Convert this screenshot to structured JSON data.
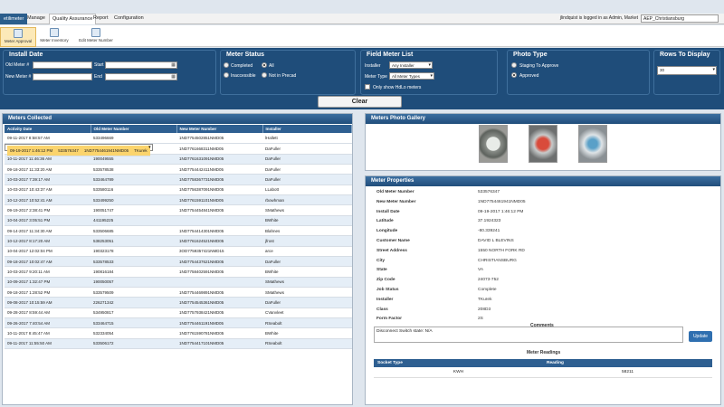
{
  "menu": {
    "items": [
      "etilimeter",
      "Manage",
      "Quality Assurance",
      "Report",
      "Configuration"
    ],
    "user_info": "jlindquist is logged in as Admin, Market",
    "market": "AEP_Christiansburg"
  },
  "ribbon": {
    "buttons": [
      "Meter Approval",
      "Meter Inventory",
      "Edit Meter Number"
    ]
  },
  "filters": {
    "install_date": {
      "title": "Install Date",
      "old_meter_label": "Old Meter #",
      "new_meter_label": "New Meter #",
      "start_label": "Start",
      "end_label": "End"
    },
    "meter_status": {
      "title": "Meter Status",
      "options": [
        "Completed",
        "All",
        "Inaccessible",
        "Not in Precad"
      ]
    },
    "field_meter_list": {
      "title": "Field Meter List",
      "installer_label": "Installer",
      "installer_value": "Any Installer",
      "meter_type_label": "Meter Type",
      "meter_type_value": "All Meter Types",
      "only_show_label": "Only show HdLo meters"
    },
    "photo_type": {
      "title": "Photo Type",
      "options": [
        "Staging To Approve",
        "Approved"
      ]
    },
    "rows_to_display": {
      "title": "Rows To Display",
      "value": "30"
    },
    "clear_label": "Clear"
  },
  "meters_collected": {
    "title": "Meters Collected",
    "columns": [
      "Activity Date",
      "Old Meter Number",
      "New Meter Number",
      "Installer"
    ],
    "rows": [
      [
        "09-11-2017 8:58:57 AM",
        "533496669",
        "1ND7754502851NMD05",
        "lHallett"
      ],
      [
        "09-19-2017 1:46:12 PM",
        "533576347",
        "1ND7754461941NMD05",
        "TKurek"
      ],
      [
        "10-10-2017 10:54:15 AM",
        "190049843",
        "1ND7761668311NMD05",
        "DaFuller"
      ],
      [
        "10-11-2017 11:46:36 AM",
        "190049555",
        "1ND7761631091NMD05",
        "DaFuller"
      ],
      [
        "09-18-2017 11:33:20 AM",
        "533578538",
        "1ND7754442411NMD05",
        "DaFuller"
      ],
      [
        "10-03-2017 7:39:17 AM",
        "533464789",
        "1ND7758367731NMD05",
        "DaFuller"
      ],
      [
        "10-03-2017 10:43:37 AM",
        "533580116",
        "1ND7756387091NMD05",
        "LLabott"
      ],
      [
        "10-12-2017 10:52:41 AM",
        "533499250",
        "1ND7761591101NMD05",
        "rbowhman"
      ],
      [
        "09-19-2017 2:38:41 PM",
        "190051747",
        "1ND7754454841NMD05",
        "SMathews"
      ],
      [
        "10-04-2017 3:05:51 PM",
        "441195225",
        "",
        "BWhite"
      ],
      [
        "09-14-2017 11:34:30 AM",
        "533506685",
        "1ND7754414301NMD05",
        "Blahnes"
      ],
      [
        "10-12-2017 8:17:20 AM",
        "538253051",
        "1ND7761624521NMD05",
        "jfrost"
      ],
      [
        "10-04-2017 12:02:04 PM",
        "190323178",
        "3OD7759357421NMD15",
        "arce"
      ],
      [
        "09-18-2017 10:02:47 AM",
        "533578533",
        "1ND7754437621NMD05",
        "DaFuller"
      ],
      [
        "10-03-2017 9:20:11 AM",
        "190816184",
        "1ND7758402591NMD05",
        "BWhite"
      ],
      [
        "10-09-2017 1:32:47 PM",
        "190050057",
        "",
        "SMathews"
      ],
      [
        "09-18-2017 1:28:52 PM",
        "533579509",
        "1ND7754469891NMD05",
        "SMathews"
      ],
      [
        "09-08-2017 10:15:59 AM",
        "226271342",
        "1ND7754545361NMD05",
        "DaFuller"
      ],
      [
        "09-28-2017 8:59:44 AM",
        "534950817",
        "1ND7757938421NMD05",
        "CVanvleet"
      ],
      [
        "09-26-2017 7:40:54 AM",
        "533464715",
        "1ND7754461191NMD05",
        "RSeabolt"
      ],
      [
        "10-11-2017 8:45:47 AM",
        "532334054",
        "1ND7761590781NMD05",
        "BWhite"
      ],
      [
        "09-11-2017 11:55:50 AM",
        "533506172",
        "1ND7754417101NMD05",
        "RSeabolt"
      ]
    ]
  },
  "gallery": {
    "title": "Meters Photo Gallery"
  },
  "properties": {
    "title": "Meter Properties",
    "fields": [
      [
        "Old Meter Number",
        "533576347"
      ],
      [
        "New Meter Number",
        "1ND7754461941NMD05"
      ],
      [
        "Install Date",
        "09-19-2017 1:46:12 PM"
      ],
      [
        "Latitude",
        "37.1924323"
      ],
      [
        "Longitude",
        "-80.339241"
      ],
      [
        "Customer Name",
        "DAVID L BLEVINS"
      ],
      [
        "Street Address",
        "1550 NORTH FORK RD"
      ],
      [
        "City",
        "CHRISTIANSBURG"
      ],
      [
        "State",
        "VA"
      ],
      [
        "Zip Code",
        "24073-752"
      ],
      [
        "Job Status",
        "Complete"
      ],
      [
        "Installer",
        "TKurek"
      ],
      [
        "Class",
        "208D3"
      ],
      [
        "Form Factor",
        "2S"
      ]
    ],
    "comments_label": "Comments",
    "comment_text": "Disconnect Switch state: N/A",
    "update_label": "Update",
    "readings_label": "Meter Readings",
    "readings_columns": [
      "Socket Type",
      "Reading"
    ],
    "readings_rows": [
      [
        "KWH",
        "58211"
      ]
    ]
  },
  "colors": {
    "header_blue": "#1f4d7a",
    "selected_row": "#fbd46d",
    "alt_row": "#e5eef7"
  }
}
